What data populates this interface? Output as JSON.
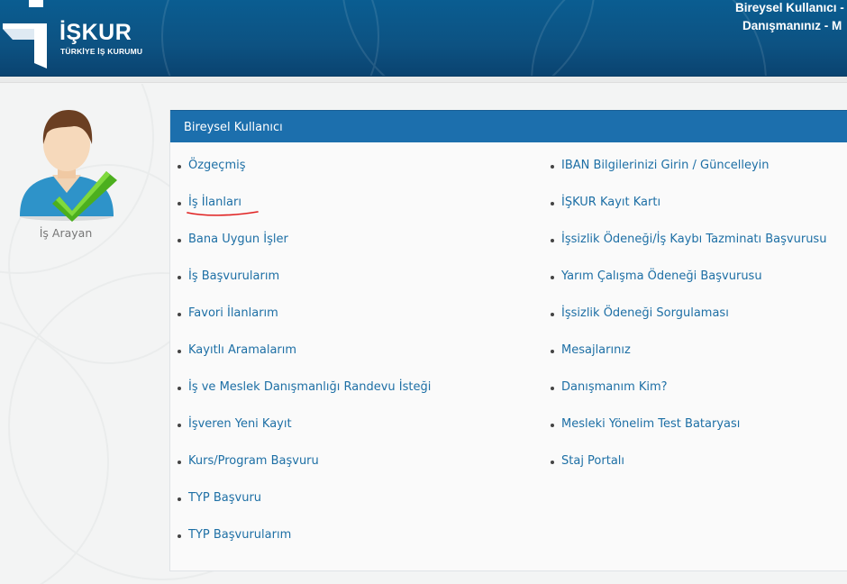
{
  "header": {
    "logo_text": "İŞKUR",
    "logo_subtitle": "TÜRKİYE İŞ KURUMU",
    "user_line1": "Bireysel Kullanıcı -",
    "user_line2": "Danışmanınız - M"
  },
  "profile": {
    "label": "İş Arayan"
  },
  "panel": {
    "title": "Bireysel Kullanıcı",
    "left_items": [
      "Özgeçmiş",
      "İş İlanları",
      "Bana Uygun İşler",
      "İş Başvurularım",
      "Favori İlanlarım",
      "Kayıtlı Aramalarım",
      "İş ve Meslek Danışmanlığı Randevu İsteği",
      "İşveren Yeni Kayıt",
      "Kurs/Program Başvuru",
      "TYP Başvuru",
      "TYP Başvurularım"
    ],
    "right_items": [
      "IBAN Bilgilerinizi Girin / Güncelleyin",
      "İŞKUR Kayıt Kartı",
      "İşsizlik Ödeneği/İş Kaybı Tazminatı Başvurusu",
      "Yarım Çalışma Ödeneği Başvurusu",
      "İşsizlik Ödeneği Sorgulaması",
      "Mesajlarınız",
      "Danışmanım Kim?",
      "Mesleki Yönelim Test Bataryası",
      "Staj Portalı"
    ]
  },
  "colors": {
    "header_blue": "#0d5282",
    "panel_header": "#1c6fad",
    "link": "#1d6fa5",
    "annotation_red": "#e02020"
  }
}
